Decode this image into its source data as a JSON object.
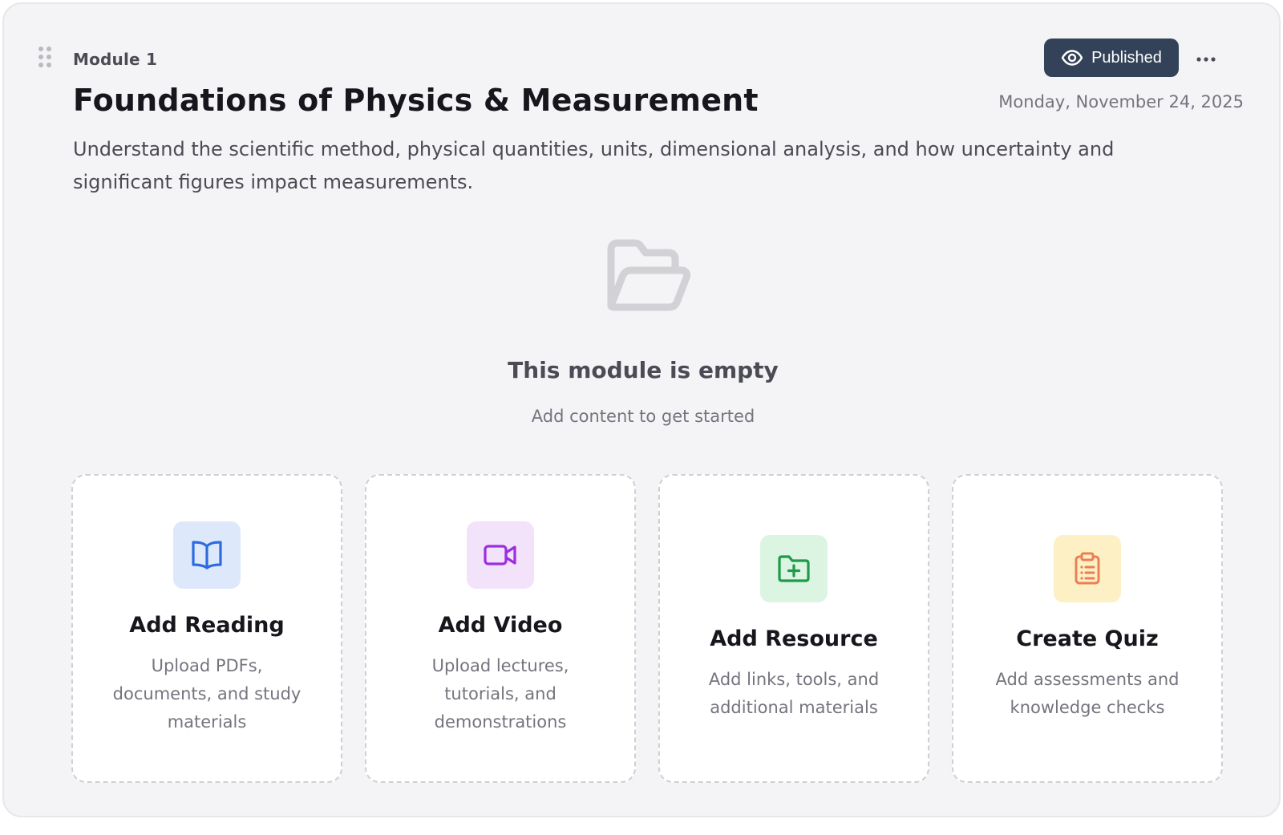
{
  "module": {
    "label": "Module 1",
    "title": "Foundations of Physics & Measurement",
    "date": "Monday, November 24, 2025",
    "description": "Understand the scientific method, physical quantities, units, dimensional analysis, and how uncertainty and significant figures impact measurements.",
    "status_label": "Published"
  },
  "empty_state": {
    "title": "This module is empty",
    "subtitle": "Add content to get started",
    "icon": "folder-open-icon"
  },
  "actions": [
    {
      "title": "Add Reading",
      "description": "Upload PDFs, documents, and study materials",
      "icon": "book-open-icon",
      "icon_color": "#2f6be0",
      "icon_bg": "#dde9fb"
    },
    {
      "title": "Add Video",
      "description": "Upload lectures, tutorials, and demonstrations",
      "icon": "video-icon",
      "icon_color": "#9b2fe0",
      "icon_bg": "#f2e3fb"
    },
    {
      "title": "Add Resource",
      "description": "Add links, tools, and additional materials",
      "icon": "folder-plus-icon",
      "icon_color": "#1e9a48",
      "icon_bg": "#dcf5e3"
    },
    {
      "title": "Create Quiz",
      "description": "Add assessments and knowledge checks",
      "icon": "clipboard-list-icon",
      "icon_color": "#ec7f55",
      "icon_bg": "#fdf0c4"
    }
  ],
  "colors": {
    "card_bg": "#f4f4f6",
    "published_bg": "#334258",
    "title_text": "#16161c",
    "muted_text": "#74747e"
  }
}
